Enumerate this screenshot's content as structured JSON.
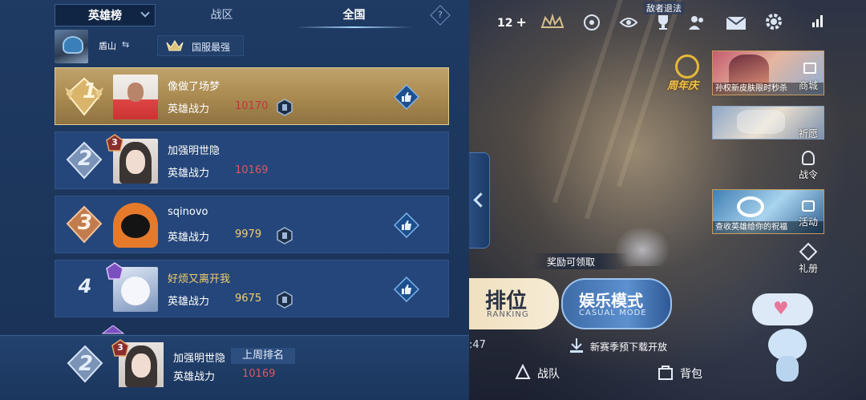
{
  "leaderboard": {
    "dropdown_label": "英雄榜",
    "tabs": [
      {
        "label": "战区",
        "active": false
      },
      {
        "label": "全国",
        "active": true
      }
    ],
    "help_label": "?",
    "me_bar": {
      "hero_name": "盾山",
      "swap_symbol": "⇆",
      "title": "国服最强"
    },
    "power_label": "英雄战力",
    "rows": [
      {
        "rank": "1",
        "name": "像做了场梦",
        "score": "10170",
        "level": "",
        "score_color": "#c7303a"
      },
      {
        "rank": "2",
        "name": "加强明世隐",
        "score": "10169",
        "level": "3",
        "score_color": "#e05560"
      },
      {
        "rank": "3",
        "name": "sqinovo",
        "score": "9979",
        "level": "",
        "score_color": "#f3d06c"
      },
      {
        "rank": "4",
        "name": "好烦又离开我",
        "score": "9675",
        "level": "",
        "score_color": "#f3d06c"
      }
    ],
    "self": {
      "rank": "2",
      "level": "3",
      "name": "加强明世隐",
      "badge": "上周排名",
      "score": "10169"
    }
  },
  "hud": {
    "counter": "12",
    "notice": "敌者退法",
    "anniversary": "周年庆",
    "mall_label": "商城",
    "mall_caption": "孙权新皮肤限时秒杀",
    "wish_label": "祈愿",
    "battlepass_label": "战令",
    "activity_label": "活动",
    "activity_caption": "查收英雄给你的祝福",
    "gift_label": "礼册",
    "reward_text": "奖励可领取",
    "rank_mode_cn": "排位",
    "rank_mode_en": "RANKING",
    "casual_mode_cn": "娱乐模式",
    "casual_mode_en": "CASUAL MODE",
    "time_fragment": ":47",
    "download_notice": "新赛季预下载开放",
    "team_label": "战队",
    "bag_label": "背包"
  },
  "colors": {
    "panel": "#1f3a63",
    "row": "#25467a",
    "gold_row": "#bfa36b",
    "highlight": "#c7303a"
  }
}
